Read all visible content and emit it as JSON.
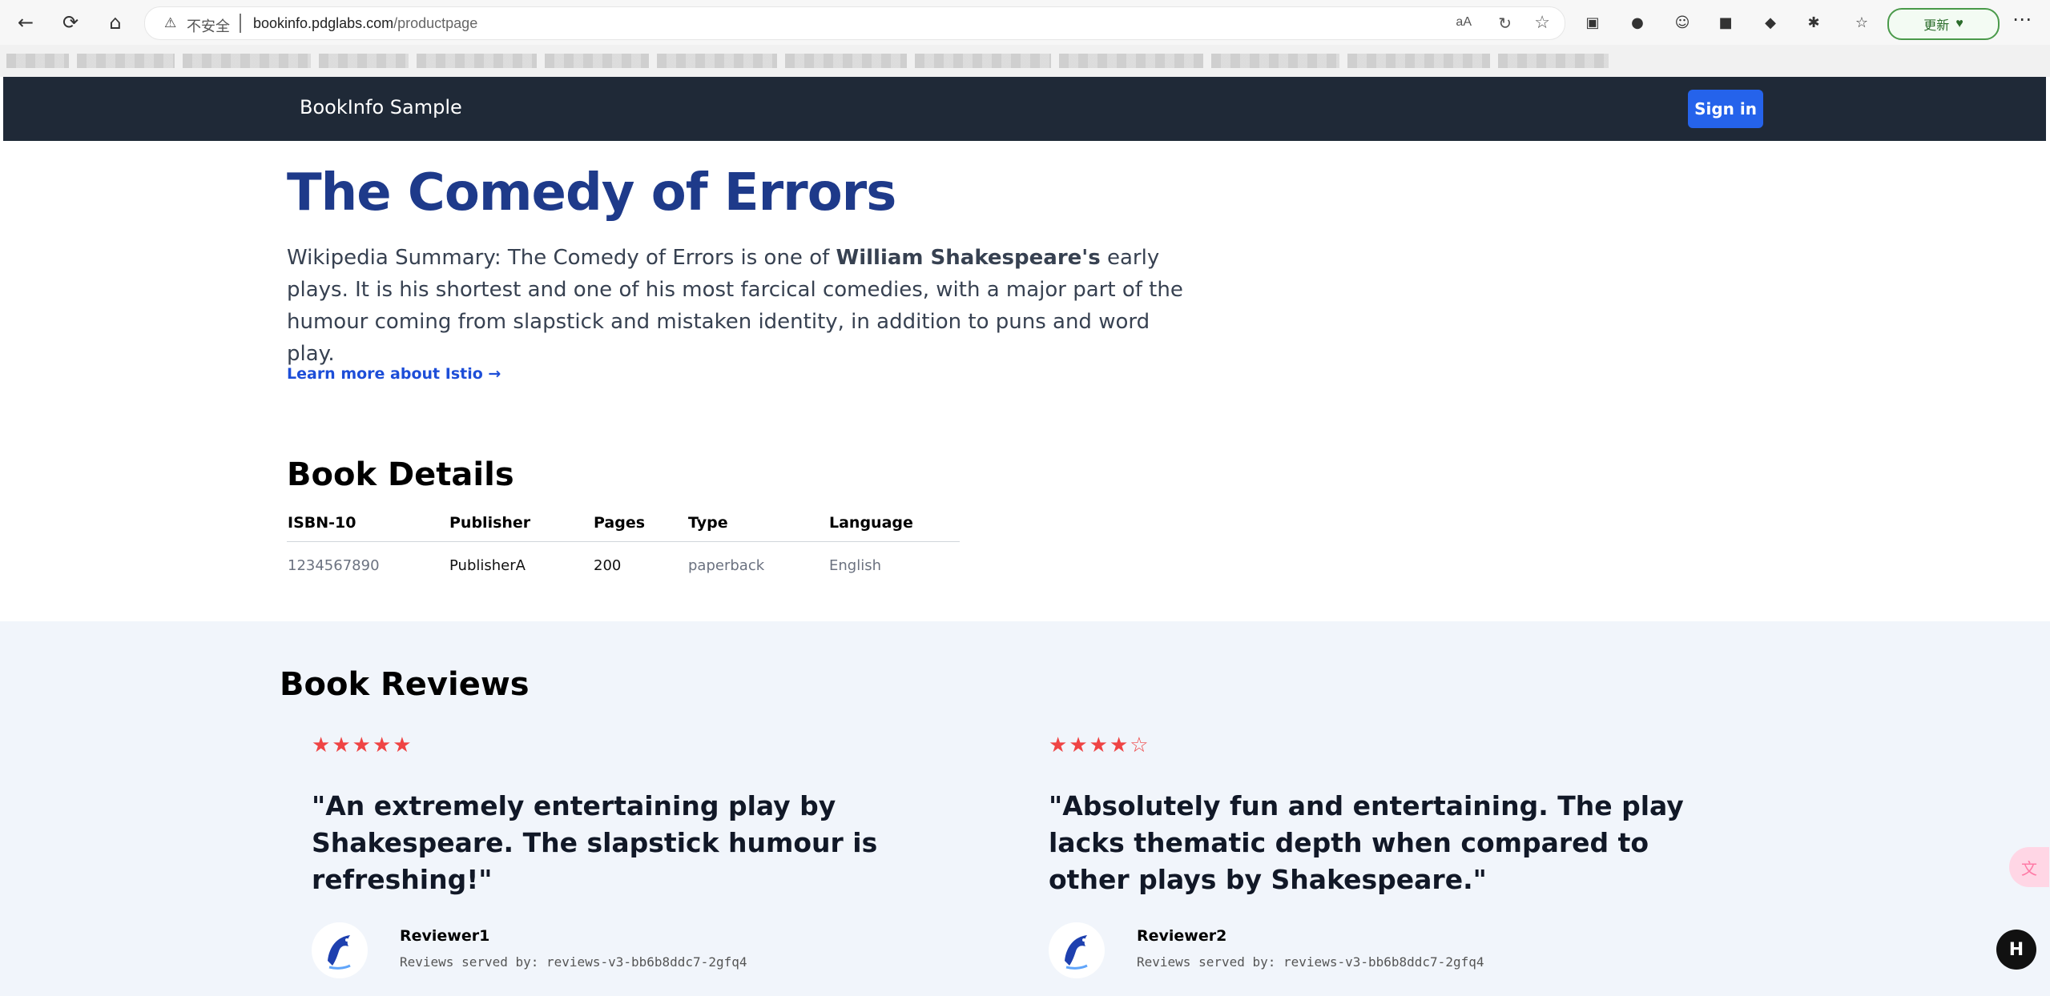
{
  "browser": {
    "insecure_label": "不安全",
    "url_host": "bookinfo.pdglabs.com",
    "url_path": "/productpage",
    "update_label": "更新"
  },
  "nav": {
    "brand": "BookInfo Sample",
    "sign_in_label": "Sign in"
  },
  "book": {
    "title": "The Comedy of Errors",
    "summary_prefix": "Wikipedia Summary: The Comedy of Errors is one of ",
    "summary_author": "William Shakespeare's",
    "summary_suffix": " early plays. It is his shortest and one of his most farcical comedies, with a major part of the humour coming from slapstick and mistaken identity, in addition to puns and word play.",
    "learn_link_label": "Learn more about Istio →"
  },
  "book_details_title": "Book Details",
  "book_details_headers": [
    "ISBN-10",
    "Publisher",
    "Pages",
    "Type",
    "Language"
  ],
  "book_details_values": {
    "isbn": "1234567890",
    "publisher": "PublisherA",
    "pages": "200",
    "type": "paperback",
    "language": "English"
  },
  "reviews_title": "Book Reviews",
  "reviews": [
    {
      "rating": 5,
      "text": "\"An extremely entertaining play by Shakespeare. The slapstick humour is refreshing!\"",
      "name": "Reviewer1",
      "served_by": "Reviews served by: reviews-v3-bb6b8ddc7-2gfq4"
    },
    {
      "rating": 4,
      "text": "\"Absolutely fun and entertaining. The play lacks thematic depth when compared to other plays by Shakespeare.\"",
      "name": "Reviewer2",
      "served_by": "Reviews served by: reviews-v3-bb6b8ddc7-2gfq4"
    }
  ],
  "stars": [
    "★",
    "★",
    "★",
    "★",
    "★"
  ],
  "stars_empty": "☆",
  "fab_label": "H"
}
